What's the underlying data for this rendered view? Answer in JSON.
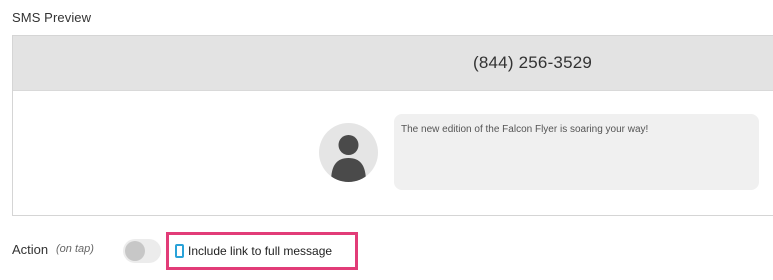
{
  "section": {
    "title": "SMS Preview"
  },
  "preview": {
    "phone_number": "(844) 256-3529",
    "message": "The new edition of the Falcon Flyer is soaring your way!",
    "avatar_icon": "user-avatar-icon"
  },
  "action": {
    "label": "Action",
    "hint": "(on tap)",
    "toggle_on": false,
    "link_option_label": "Include link to full message",
    "link_option_checked": false,
    "highlight_color": "#e23c78",
    "checkbox_color": "#29a2d8"
  }
}
